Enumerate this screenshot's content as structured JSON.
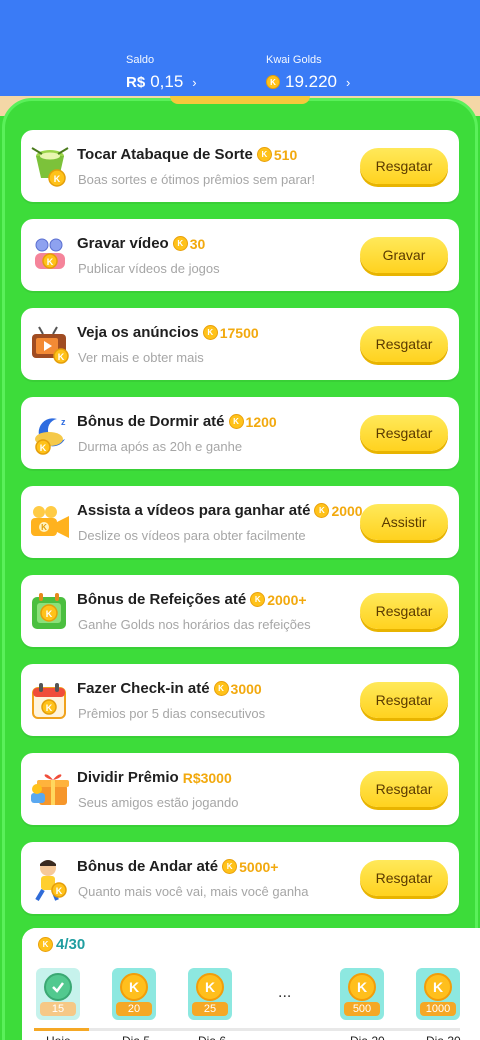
{
  "header": {
    "saldo_label": "Saldo",
    "saldo_currency": "R$",
    "saldo_value": "0,15",
    "golds_label": "Kwai Golds",
    "golds_value": "19.220",
    "chevron": "›"
  },
  "coin_letter": "K",
  "tasks": [
    {
      "title": "Tocar Atabaque de Sorte",
      "amount": "510",
      "subtitle": "Boas sortes e ótimos prêmios sem parar!",
      "button": "Resgatar",
      "icon": "drum-icon"
    },
    {
      "title": "Gravar vídeo",
      "amount": "30",
      "subtitle": "Publicar vídeos de jogos",
      "button": "Gravar",
      "icon": "camera-record-icon"
    },
    {
      "title": "Veja os anúncios",
      "amount": "17500",
      "subtitle": "Ver mais e obter mais",
      "button": "Resgatar",
      "icon": "tv-icon"
    },
    {
      "title": "Bônus de Dormir até",
      "amount": "1200",
      "subtitle": "Durma após as 20h e ganhe",
      "button": "Resgatar",
      "icon": "moon-sleep-icon"
    },
    {
      "title": "Assista a vídeos para ganhar até",
      "amount": "2000",
      "subtitle": "Deslize os vídeos para obter facilmente",
      "button": "Assistir",
      "icon": "video-camera-icon"
    },
    {
      "title": "Bônus de Refeições até",
      "amount": "2000+",
      "subtitle": "Ganhe Golds nos horários das refeições",
      "button": "Resgatar",
      "icon": "meal-calendar-icon"
    },
    {
      "title": "Fazer Check-in até",
      "amount": "3000",
      "subtitle": "Prêmios por 5 dias consecutivos",
      "button": "Resgatar",
      "icon": "calendar-icon"
    },
    {
      "title": "Dividir Prêmio",
      "amount": "R$3000",
      "subtitle": "Seus amigos estão jogando",
      "button": "Resgatar",
      "icon": "gift-icon"
    },
    {
      "title": "Bônus de Andar até",
      "amount": "5000+",
      "subtitle": "Quanto mais você vai, mais você ganha",
      "button": "Resgatar",
      "icon": "walking-boy-icon"
    }
  ],
  "checkin": {
    "count": "4/30",
    "days": [
      {
        "value": "15",
        "done": true
      },
      {
        "value": "20",
        "done": false
      },
      {
        "value": "25",
        "done": false
      },
      {
        "value": "500",
        "done": false
      },
      {
        "value": "1000",
        "done": false
      }
    ],
    "ellipsis": "...",
    "labels": [
      "Hoje",
      "Dia 5",
      "Dia 6",
      "Dia 20",
      "Dia 30"
    ],
    "progress": 0.13
  },
  "colors": {
    "accent_blue": "#3a7bf6",
    "background_green": "#3ddc3a",
    "button_yellow": "#ffd21f",
    "coin_gold": "#ffc21a"
  }
}
